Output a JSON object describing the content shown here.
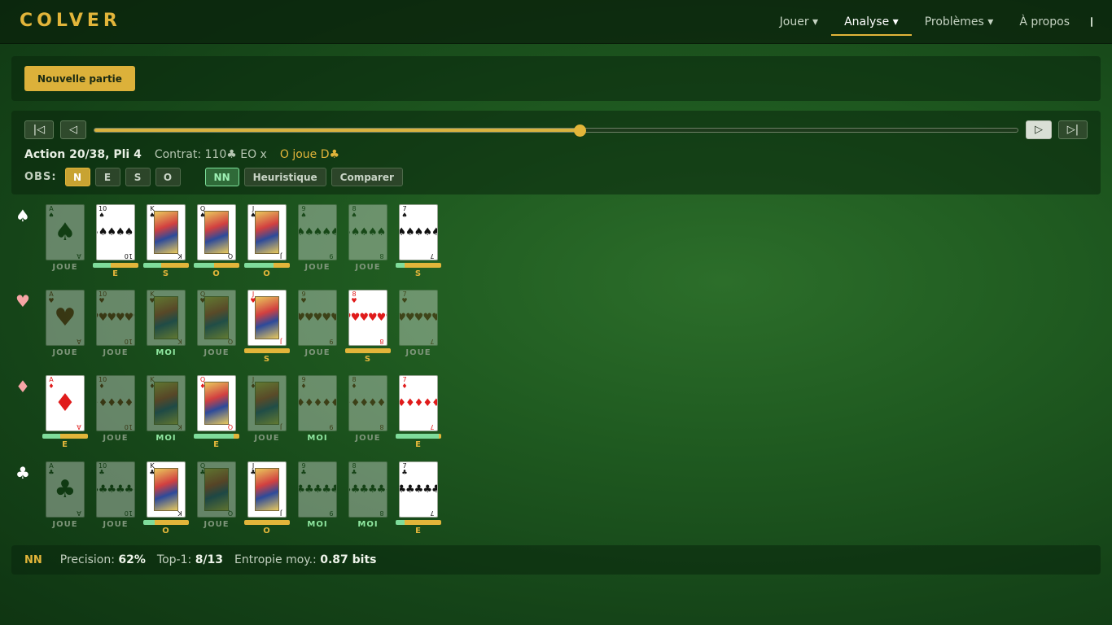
{
  "app": {
    "logo": "COLVER"
  },
  "nav": {
    "items": [
      {
        "label": "Jouer ▾",
        "active": false
      },
      {
        "label": "Analyse ▾",
        "active": true
      },
      {
        "label": "Problèmes ▾",
        "active": false
      },
      {
        "label": "À propos",
        "active": false
      }
    ],
    "theme_icon": "theme-toggle-icon"
  },
  "toolbar": {
    "new_game_label": "Nouvelle partie"
  },
  "replay": {
    "first_icon": "|◁",
    "prev_icon": "◁",
    "next_icon": "▷",
    "last_icon": "▷|",
    "progress_fraction": 0.526,
    "action_label": "Action 20/38, Pli 4",
    "contract_label": "Contrat: 110♣ EO x",
    "play_label": "O joue D♣",
    "obs_label": "OBS:",
    "seats": [
      {
        "label": "N",
        "selected": true
      },
      {
        "label": "E",
        "selected": false
      },
      {
        "label": "S",
        "selected": false
      },
      {
        "label": "O",
        "selected": false
      }
    ],
    "modes": [
      {
        "label": "NN",
        "selected": true
      },
      {
        "label": "Heuristique",
        "selected": false
      },
      {
        "label": "Comparer",
        "selected": false
      }
    ]
  },
  "colors": {
    "accent": "#e2b53a",
    "moi": "#8fe6a0",
    "joue": "#7e957a",
    "prob_green": "#7fdc9b"
  },
  "suits": [
    {
      "symbol": "♠",
      "red": false,
      "cards": [
        {
          "rank": "A",
          "status": "played",
          "label": "JOUE"
        },
        {
          "rank": "10",
          "status": "active",
          "label": "E",
          "prob": 0.4
        },
        {
          "rank": "K",
          "status": "active",
          "label": "S",
          "prob": 0.4
        },
        {
          "rank": "Q",
          "status": "active",
          "label": "O",
          "prob": 0.45
        },
        {
          "rank": "J",
          "status": "active",
          "label": "O",
          "prob": 0.65
        },
        {
          "rank": "9",
          "status": "played",
          "label": "JOUE"
        },
        {
          "rank": "8",
          "status": "played",
          "label": "JOUE"
        },
        {
          "rank": "7",
          "status": "active",
          "label": "S",
          "prob": 0.2
        }
      ]
    },
    {
      "symbol": "♥",
      "red": true,
      "cards": [
        {
          "rank": "A",
          "status": "played",
          "label": "JOUE"
        },
        {
          "rank": "10",
          "status": "played",
          "label": "JOUE"
        },
        {
          "rank": "K",
          "status": "mine",
          "label": "MOI"
        },
        {
          "rank": "Q",
          "status": "played",
          "label": "JOUE"
        },
        {
          "rank": "J",
          "status": "active",
          "label": "S",
          "prob": 0.0
        },
        {
          "rank": "9",
          "status": "played",
          "label": "JOUE"
        },
        {
          "rank": "8",
          "status": "active",
          "label": "S",
          "prob": 0.0
        },
        {
          "rank": "7",
          "status": "played",
          "label": "JOUE"
        }
      ]
    },
    {
      "symbol": "♦",
      "red": true,
      "cards": [
        {
          "rank": "A",
          "status": "active",
          "label": "E",
          "prob": 0.4
        },
        {
          "rank": "10",
          "status": "played",
          "label": "JOUE"
        },
        {
          "rank": "K",
          "status": "mine",
          "label": "MOI"
        },
        {
          "rank": "Q",
          "status": "active",
          "label": "E",
          "prob": 0.88
        },
        {
          "rank": "J",
          "status": "played",
          "label": "JOUE"
        },
        {
          "rank": "9",
          "status": "mine",
          "label": "MOI"
        },
        {
          "rank": "8",
          "status": "played",
          "label": "JOUE"
        },
        {
          "rank": "7",
          "status": "active",
          "label": "E",
          "prob": 0.95
        }
      ]
    },
    {
      "symbol": "♣",
      "red": false,
      "cards": [
        {
          "rank": "A",
          "status": "played",
          "label": "JOUE"
        },
        {
          "rank": "10",
          "status": "played",
          "label": "JOUE"
        },
        {
          "rank": "K",
          "status": "active",
          "label": "O",
          "prob": 0.25
        },
        {
          "rank": "Q",
          "status": "played",
          "label": "JOUE"
        },
        {
          "rank": "J",
          "status": "active",
          "label": "O",
          "prob": 0.0
        },
        {
          "rank": "9",
          "status": "mine",
          "label": "MOI"
        },
        {
          "rank": "8",
          "status": "mine",
          "label": "MOI"
        },
        {
          "rank": "7",
          "status": "active",
          "label": "E",
          "prob": 0.2
        }
      ]
    }
  ],
  "footer": {
    "model": "NN",
    "precision_label": "Precision:",
    "precision_value": "62%",
    "top1_label": "Top-1:",
    "top1_value": "8/13",
    "entropy_label": "Entropie moy.:",
    "entropy_value": "0.87 bits"
  }
}
